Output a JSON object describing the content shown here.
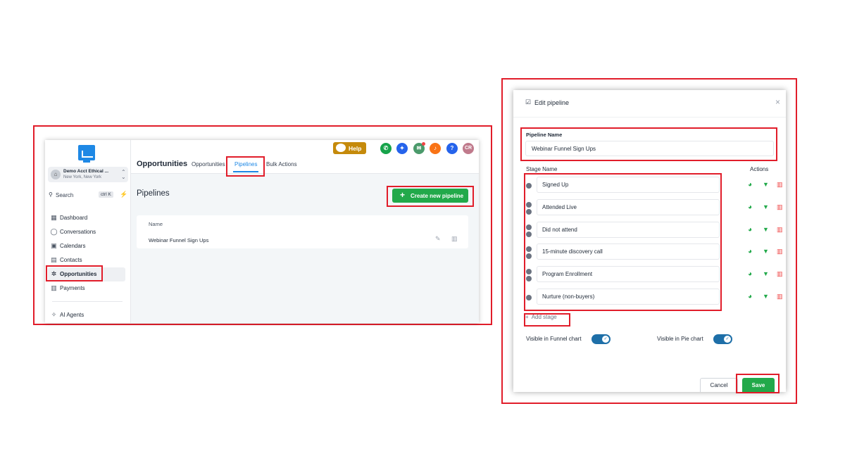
{
  "app": {
    "account": {
      "name": "Demo Acct Ethical ...",
      "location": "New York, New York"
    },
    "search": {
      "label": "Search",
      "shortcut": "ctrl K"
    },
    "nav": [
      {
        "label": "Dashboard",
        "icon": "grid-icon"
      },
      {
        "label": "Conversations",
        "icon": "chat-icon"
      },
      {
        "label": "Calendars",
        "icon": "calendar-icon"
      },
      {
        "label": "Contacts",
        "icon": "contacts-icon"
      },
      {
        "label": "Opportunities",
        "icon": "opportunities-icon"
      },
      {
        "label": "Payments",
        "icon": "payments-icon"
      },
      {
        "label": "AI Agents",
        "icon": "sparkle-icon"
      }
    ],
    "header": {
      "title": "Opportunities",
      "tabs": [
        "Opportunities",
        "Pipelines",
        "Bulk Actions"
      ],
      "active_tab": "Pipelines",
      "help_label": "Help",
      "avatar_initials": "CR",
      "question_mark": "?"
    },
    "main": {
      "title": "Pipelines",
      "create_button": "Create new pipeline",
      "table_header": "Name",
      "rows": [
        "Webinar Funnel Sign Ups"
      ]
    }
  },
  "modal": {
    "title": "Edit pipeline",
    "pipeline_name_label": "Pipeline Name",
    "pipeline_name_value": "Webinar Funnel Sign Ups",
    "stage_name_label": "Stage Name",
    "actions_label": "Actions",
    "stages": [
      "Signed Up",
      "Attended Live",
      "Did not attend",
      "15-minute discovery call",
      "Program Enrollment",
      "Nurture (non-buyers)"
    ],
    "add_stage": "Add stage",
    "funnel_toggle_label": "Visible in Funnel chart",
    "pie_toggle_label": "Visible in Pie chart",
    "funnel_toggle_on": true,
    "pie_toggle_on": true,
    "cancel": "Cancel",
    "save": "Save"
  },
  "colors": {
    "highlight": "#e11d2a",
    "primary_green": "#22a94a",
    "link_blue": "#1e88e5",
    "help_gold": "#c58a0b"
  }
}
